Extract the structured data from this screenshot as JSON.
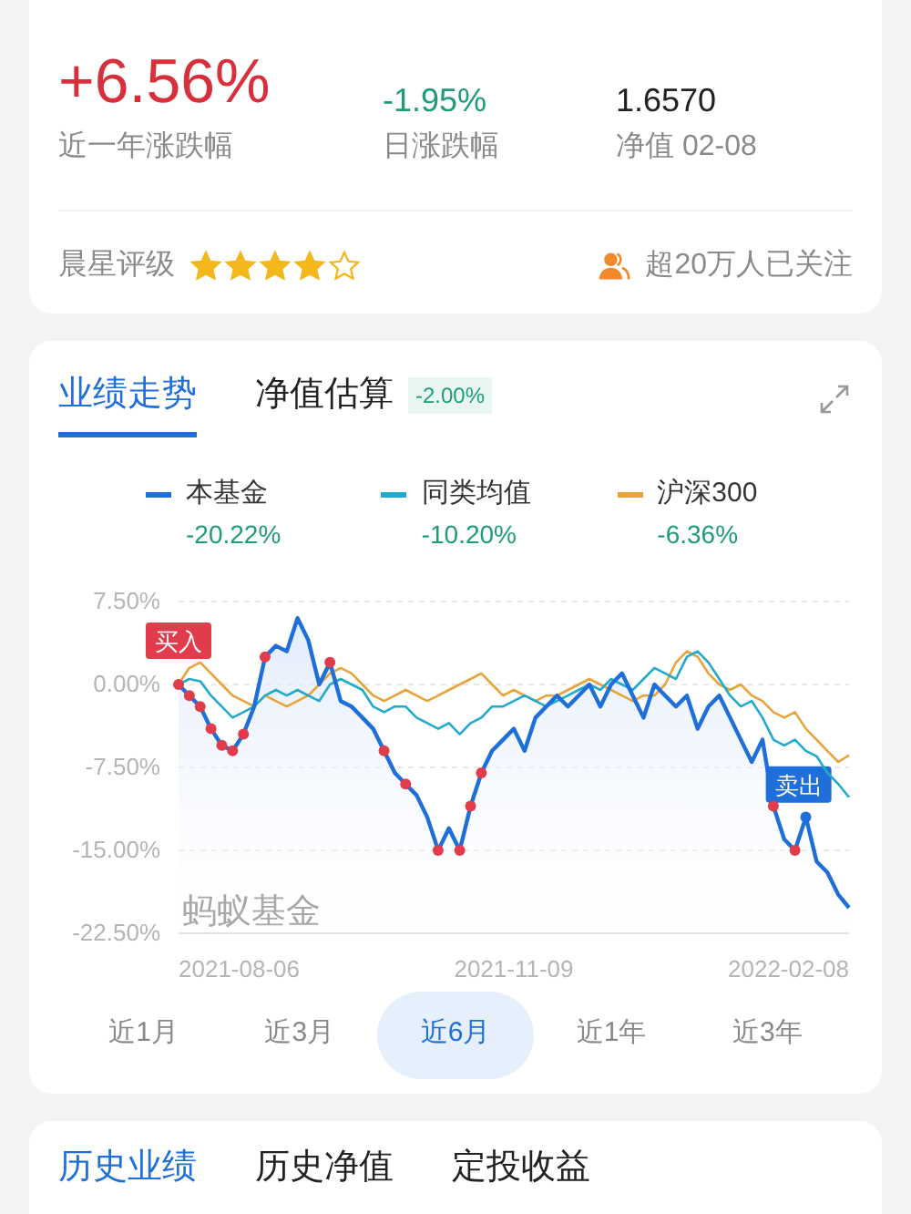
{
  "summary": {
    "stats": [
      {
        "kind": "main",
        "value": "+6.56%",
        "label": "近一年涨跌幅"
      },
      {
        "kind": "down",
        "value": "-1.95%",
        "label": "日涨跌幅"
      },
      {
        "kind": "plain",
        "value": "1.6570",
        "label": "净值 02-08"
      }
    ],
    "rating_label": "晨星评级",
    "stars": 4,
    "followers": "超20万人已关注"
  },
  "performance": {
    "tabs": [
      {
        "label": "业绩走势",
        "selected": true
      },
      {
        "label": "净值估算",
        "selected": false,
        "badge": "-2.00%"
      }
    ],
    "legend_values": [
      "-20.22%",
      "-10.20%",
      "-6.36%"
    ],
    "markers": [
      {
        "kind": "buy",
        "label": "买入"
      },
      {
        "kind": "sell",
        "label": "卖出"
      }
    ],
    "x_labels": [
      "2021-08-06",
      "2021-11-09",
      "2022-02-08"
    ],
    "watermark": "蚂蚁基金",
    "chart_data": {
      "type": "line",
      "ylim": [
        -22.5,
        7.5
      ],
      "yticks": [
        {
          "value": 7.5,
          "label": "7.50%"
        },
        {
          "value": 0,
          "label": "0.00%"
        },
        {
          "value": -7.5,
          "label": "-7.50%"
        },
        {
          "value": -15,
          "label": "-15.00%"
        },
        {
          "value": -22.5,
          "label": "-22.50%"
        }
      ],
      "grid": true,
      "series": [
        {
          "name": "本基金",
          "color": "#1e6fd9",
          "values": [
            0,
            -1,
            -2,
            -4,
            -5.5,
            -6,
            -4.5,
            -2,
            2.5,
            3.5,
            3,
            6,
            4,
            0,
            2,
            -1.5,
            -2,
            -3,
            -4,
            -6,
            -8,
            -9,
            -10,
            -12,
            -15,
            -13,
            -15,
            -11,
            -8,
            -6,
            -5,
            -4,
            -6,
            -3,
            -2,
            -1,
            -2,
            -1,
            0,
            -2,
            0,
            1,
            -1,
            -3,
            0,
            -1,
            -2,
            -1,
            -4,
            -2,
            -1,
            -3,
            -5,
            -7,
            -5,
            -11,
            -14,
            -15,
            -12,
            -16,
            -17,
            -19,
            -20.2
          ]
        },
        {
          "name": "同类均值",
          "color": "#22aacc",
          "values": [
            0,
            0.5,
            0.3,
            -1,
            -2,
            -3,
            -2.5,
            -2,
            -1,
            -0.5,
            -1,
            -0.5,
            -1,
            -1.5,
            0,
            0.5,
            0,
            -0.5,
            -2,
            -2.5,
            -2,
            -2,
            -3,
            -3.5,
            -4,
            -3.5,
            -4.5,
            -3.5,
            -3,
            -2,
            -2,
            -1.5,
            -1,
            -1.5,
            -2,
            -1.5,
            -1,
            -0.5,
            0,
            -0.5,
            0.5,
            0,
            -0.5,
            0.5,
            1.5,
            1,
            0.5,
            2.5,
            3,
            2,
            0.5,
            -1,
            -2,
            -1.5,
            -3,
            -5,
            -5.5,
            -5,
            -6,
            -6.5,
            -8,
            -9,
            -10.2
          ]
        },
        {
          "name": "沪深300",
          "color": "#e8a43a",
          "values": [
            0,
            1.5,
            2,
            1,
            0,
            -1,
            -1.5,
            -2,
            -1,
            -1.5,
            -2,
            -1.5,
            -1,
            0,
            1,
            1.5,
            1,
            0,
            -1,
            -1.5,
            -1,
            -0.5,
            -1,
            -1.5,
            -1,
            -0.5,
            0,
            0.5,
            1,
            0,
            -1,
            -0.5,
            -1,
            -1.5,
            -1,
            -1,
            -0.5,
            0,
            0.5,
            0,
            -0.5,
            -1,
            -1.5,
            -1,
            -1,
            0,
            2,
            3,
            2.5,
            1,
            0,
            -0.5,
            0,
            -1,
            -1.5,
            -2.5,
            -3,
            -2.5,
            -4,
            -5,
            -6,
            -7,
            -6.4
          ]
        }
      ]
    },
    "ranges": [
      {
        "label": "近1月",
        "selected": false
      },
      {
        "label": "近3月",
        "selected": false
      },
      {
        "label": "近6月",
        "selected": true
      },
      {
        "label": "近1年",
        "selected": false
      },
      {
        "label": "近3年",
        "selected": false
      }
    ]
  },
  "history": {
    "tabs": [
      {
        "label": "历史业绩",
        "selected": true
      },
      {
        "label": "历史净值",
        "selected": false
      },
      {
        "label": "定投收益",
        "selected": false
      }
    ]
  }
}
